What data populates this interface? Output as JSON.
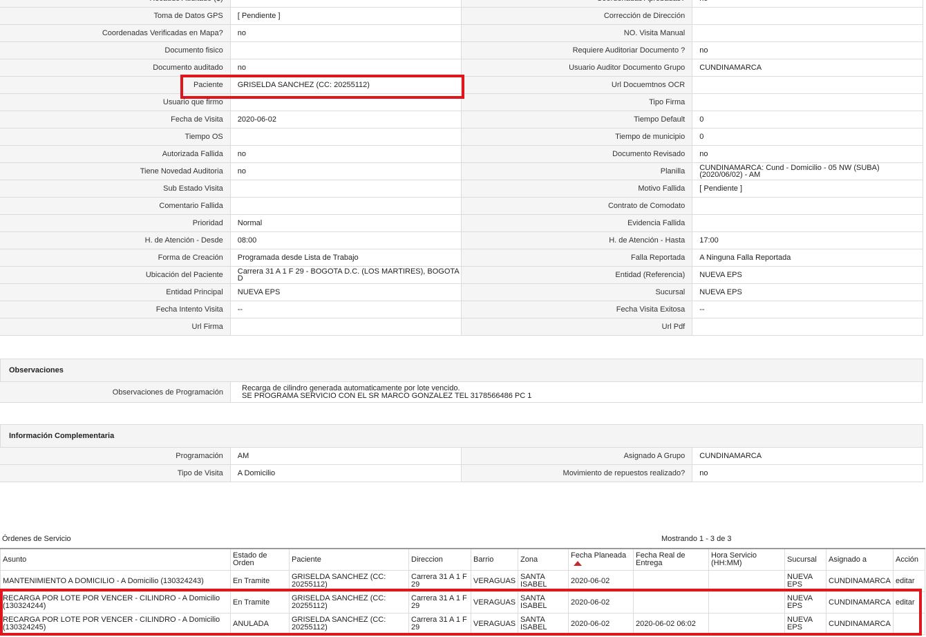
{
  "details": [
    {
      "l1": "Recaudo Auditado ($)",
      "v1": "",
      "l2": "Coordenadas Aprobadas?",
      "v2": "no"
    },
    {
      "l1": "Toma de Datos GPS",
      "v1": "[ Pendiente ]",
      "l2": "Corrección de Dirección",
      "v2": ""
    },
    {
      "l1": "Coordenadas Verificadas en Mapa?",
      "v1": "no",
      "l2": "NO. Visita Manual",
      "v2": ""
    },
    {
      "l1": "Documento fisico",
      "v1": "",
      "l2": "Requiere Auditoriar Documento ?",
      "v2": "no"
    },
    {
      "l1": "Documento auditado",
      "v1": "no",
      "l2": "Usuario Auditor Documento Grupo",
      "v2": "CUNDINAMARCA"
    },
    {
      "l1": "Paciente",
      "v1": "GRISELDA SANCHEZ (CC: 20255112)",
      "l2": "Url Docuemtnos OCR",
      "v2": ""
    },
    {
      "l1": "Usuario que firmo",
      "v1": "",
      "l2": "Tipo Firma",
      "v2": ""
    },
    {
      "l1": "Fecha de Visita",
      "v1": "2020-06-02",
      "l2": "Tiempo Default",
      "v2": "0"
    },
    {
      "l1": "Tiempo OS",
      "v1": "",
      "l2": "Tiempo de municipio",
      "v2": "0"
    },
    {
      "l1": "Autorizada Fallida",
      "v1": "no",
      "l2": "Documento Revisado",
      "v2": "no"
    },
    {
      "l1": "Tiene Novedad Auditoria",
      "v1": "no",
      "l2": "Planilla",
      "v2": "CUNDINAMARCA: Cund - Domicilio - 05 NW (SUBA) (2020/06/02) - AM"
    },
    {
      "l1": "Sub Estado Visita",
      "v1": "",
      "l2": "Motivo Fallida",
      "v2": "[ Pendiente ]"
    },
    {
      "l1": "Comentario Fallida",
      "v1": "",
      "l2": "Contrato de Comodato",
      "v2": ""
    },
    {
      "l1": "Prioridad",
      "v1": "Normal",
      "l2": "Evidencia Fallida",
      "v2": ""
    },
    {
      "l1": "H. de Atención - Desde",
      "v1": "08:00",
      "l2": "H. de Atención - Hasta",
      "v2": "17:00"
    },
    {
      "l1": "Forma de Creación",
      "v1": "Programada desde Lista de Trabajo",
      "l2": "Falla Reportada",
      "v2": "A Ninguna Falla Reportada"
    },
    {
      "l1": "Ubicación del Paciente",
      "v1": "Carrera 31 A 1 F 29 - BOGOTA D.C. (LOS MARTIRES), BOGOTA D",
      "l2": "Entidad (Referencia)",
      "v2": "NUEVA EPS"
    },
    {
      "l1": "Entidad Principal",
      "v1": "NUEVA EPS",
      "l2": "Sucursal",
      "v2": "NUEVA EPS"
    },
    {
      "l1": "Fecha Intento Visita",
      "v1": "--",
      "l2": "Fecha Visita Exitosa",
      "v2": "--"
    },
    {
      "l1": "Url Firma",
      "v1": "",
      "l2": "Url Pdf",
      "v2": ""
    }
  ],
  "observaciones": {
    "title": "Observaciones",
    "label": "Observaciones de Programación",
    "line1": "Recarga de cilindro generada automaticamente por lote vencido.",
    "line2": "SE PROGRAMA SERVICIO CON EL SR MARCO GONZALEZ TEL 3178566486 PC 1"
  },
  "complementaria": {
    "title": "Información Complementaria",
    "rows": [
      {
        "l1": "Programación",
        "v1": "AM",
        "l2": "Asignado A Grupo",
        "v2": "CUNDINAMARCA"
      },
      {
        "l1": "Tipo de Visita",
        "v1": "A Domicilio",
        "l2": "Movimiento de repuestos realizado?",
        "v2": "no"
      }
    ]
  },
  "orders": {
    "title": "Órdenes de Servicio",
    "count": "Mostrando 1 - 3 de 3",
    "headers": [
      "Asunto",
      "Estado de Orden",
      "Paciente",
      "Direccion",
      "Barrio",
      "Zona",
      "Fecha Planeada",
      "Fecha Real de Entrega",
      "Hora Servicio (HH:MM)",
      "Sucursal",
      "Asignado a",
      "Acción"
    ],
    "rows": [
      [
        "MANTENIMIENTO A DOMICILIO - A Domicilio (130324243)",
        "En Tramite",
        "GRISELDA SANCHEZ (CC: 20255112)",
        "Carrera 31 A 1 F 29",
        "VERAGUAS",
        "SANTA ISABEL",
        "2020-06-02",
        "",
        "",
        "NUEVA EPS",
        "CUNDINAMARCA",
        "editar"
      ],
      [
        "RECARGA POR LOTE POR VENCER - CILINDRO - A Domicilio (130324244)",
        "En Tramite",
        "GRISELDA SANCHEZ (CC: 20255112)",
        "Carrera 31 A 1 F 29",
        "VERAGUAS",
        "SANTA ISABEL",
        "2020-06-02",
        "",
        "",
        "NUEVA EPS",
        "CUNDINAMARCA",
        "editar"
      ],
      [
        "RECARGA POR LOTE POR VENCER - CILINDRO - A Domicilio (130324245)",
        "ANULADA",
        "GRISELDA SANCHEZ (CC: 20255112)",
        "Carrera 31 A 1 F 29",
        "VERAGUAS",
        "SANTA ISABEL",
        "2020-06-02",
        "2020-06-02 06:02",
        "",
        "NUEVA EPS",
        "CUNDINAMARCA",
        ""
      ]
    ]
  },
  "colors": {
    "highlight": "#e0161e",
    "sort": "#c62b2b"
  },
  "icons": {
    "sort": "sort-ascending-icon"
  }
}
